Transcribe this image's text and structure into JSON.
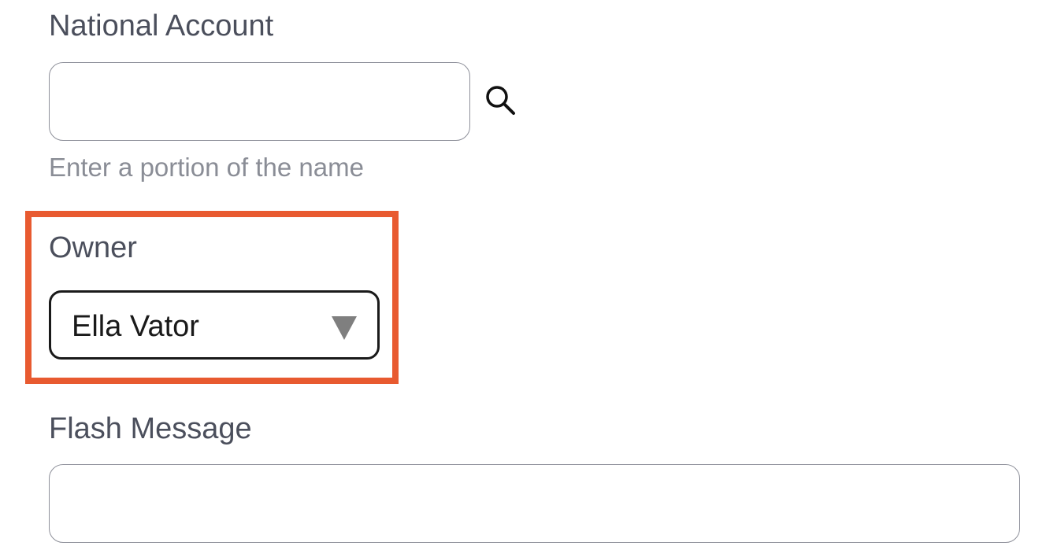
{
  "national_account": {
    "label": "National Account",
    "value": "",
    "hint": "Enter a portion of the name",
    "search_icon": "search-icon"
  },
  "owner": {
    "label": "Owner",
    "selected": "Ella Vator",
    "dropdown_icon": "triangle-down-icon"
  },
  "flash_message": {
    "label": "Flash Message",
    "value": ""
  },
  "colors": {
    "highlight": "#e85a30",
    "label_text": "#4b4f5c",
    "hint_text": "#8a8d96",
    "input_border": "#8e909a"
  }
}
